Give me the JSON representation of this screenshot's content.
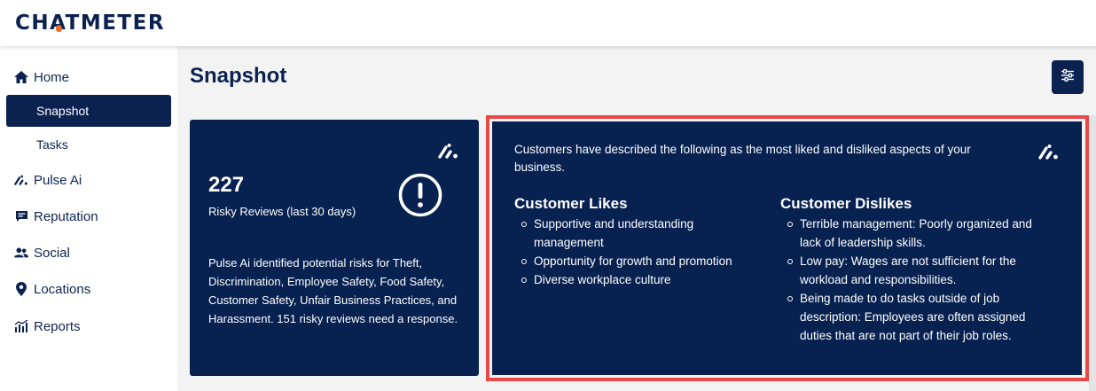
{
  "brand": {
    "name": "CHATMETER"
  },
  "sidebar": {
    "items": [
      {
        "label": "Home",
        "icon": "home-icon"
      },
      {
        "label": "Snapshot",
        "active": true
      },
      {
        "label": "Tasks"
      },
      {
        "label": "Pulse Ai",
        "icon": "pulse-ai-icon"
      },
      {
        "label": "Reputation",
        "icon": "chat-bubble-icon"
      },
      {
        "label": "Social",
        "icon": "users-icon"
      },
      {
        "label": "Locations",
        "icon": "map-pin-icon"
      },
      {
        "label": "Reports",
        "icon": "chart-icon"
      }
    ]
  },
  "page": {
    "title": "Snapshot",
    "filter_icon": "sliders-icon"
  },
  "risk_card": {
    "count": "227",
    "label": "Risky Reviews (last 30 days)",
    "description": "Pulse Ai identified potential risks for Theft, Discrimination, Employee Safety, Food Safety, Customer Safety, Unfair Business Practices, and Harassment. 151 risky reviews need a response.",
    "icon": "exclamation-circle-icon"
  },
  "aspects_card": {
    "intro": "Customers have described the following as the most liked and disliked aspects of your business.",
    "likes": {
      "title": "Customer Likes",
      "items": [
        "Supportive and understanding management",
        "Opportunity for growth and promotion",
        "Diverse workplace culture"
      ]
    },
    "dislikes": {
      "title": "Customer Dislikes",
      "items": [
        "Terrible management: Poorly organized and lack of leadership skills.",
        "Low pay: Wages are not sufficient for the workload and responsibilities.",
        "Being made to do tasks outside of job description: Employees are often assigned duties that are not part of their job roles."
      ]
    }
  },
  "colors": {
    "navy": "#072150",
    "accent_orange": "#f26a21",
    "highlight_red": "#ea4749",
    "background": "#f3f3f3"
  }
}
